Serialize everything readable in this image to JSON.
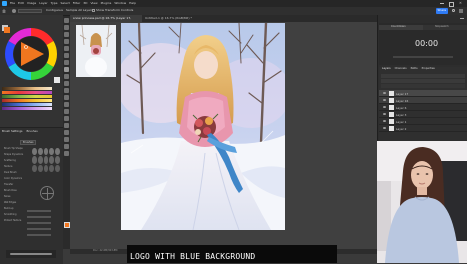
{
  "menu": {
    "items": [
      "File",
      "Edit",
      "Image",
      "Layer",
      "Type",
      "Select",
      "Filter",
      "3D",
      "View",
      "Plugins",
      "Window",
      "Help"
    ],
    "share_label": "Share"
  },
  "options": {
    "items": [
      "Contiguous",
      "Sample All Layers",
      "Show Transform Controls"
    ]
  },
  "tabs": [
    {
      "label": "snow princess.psd @ 16.7% (Layer 17, RGB/8#) *"
    },
    {
      "label": "Untitled-1 @ 16.7% (RGB/8#) *"
    }
  ],
  "status": {
    "text": "Doc: 22.6M/303.8M"
  },
  "timer": {
    "tabs": [
      "Countdown",
      "Stopwatch"
    ],
    "value": "00:00"
  },
  "layers": {
    "tabs": [
      "Layers",
      "Channels",
      "Paths",
      "Properties"
    ],
    "items": [
      "Layer 17",
      "Layer 16",
      "Layer 6",
      "Layer 3",
      "Layer 1",
      "Layer 2"
    ]
  },
  "brush_panel": {
    "tabs": [
      "Brush Settings",
      "Brushes"
    ],
    "button": "Brushes",
    "options": [
      "Brush Tip Shape",
      "Shape Dynamics",
      "Scattering",
      "Texture",
      "Dual Brush",
      "Color Dynamics",
      "Transfer",
      "Brush Pose",
      "Noise",
      "Wet Edges",
      "Build-up",
      "Smoothing",
      "Protect Texture"
    ]
  },
  "caption": {
    "text": "LOGO WITH BLUE BACKGROUND"
  },
  "colors": {
    "accent": "#2f7bf5",
    "swatch_current": "#f0761f"
  }
}
